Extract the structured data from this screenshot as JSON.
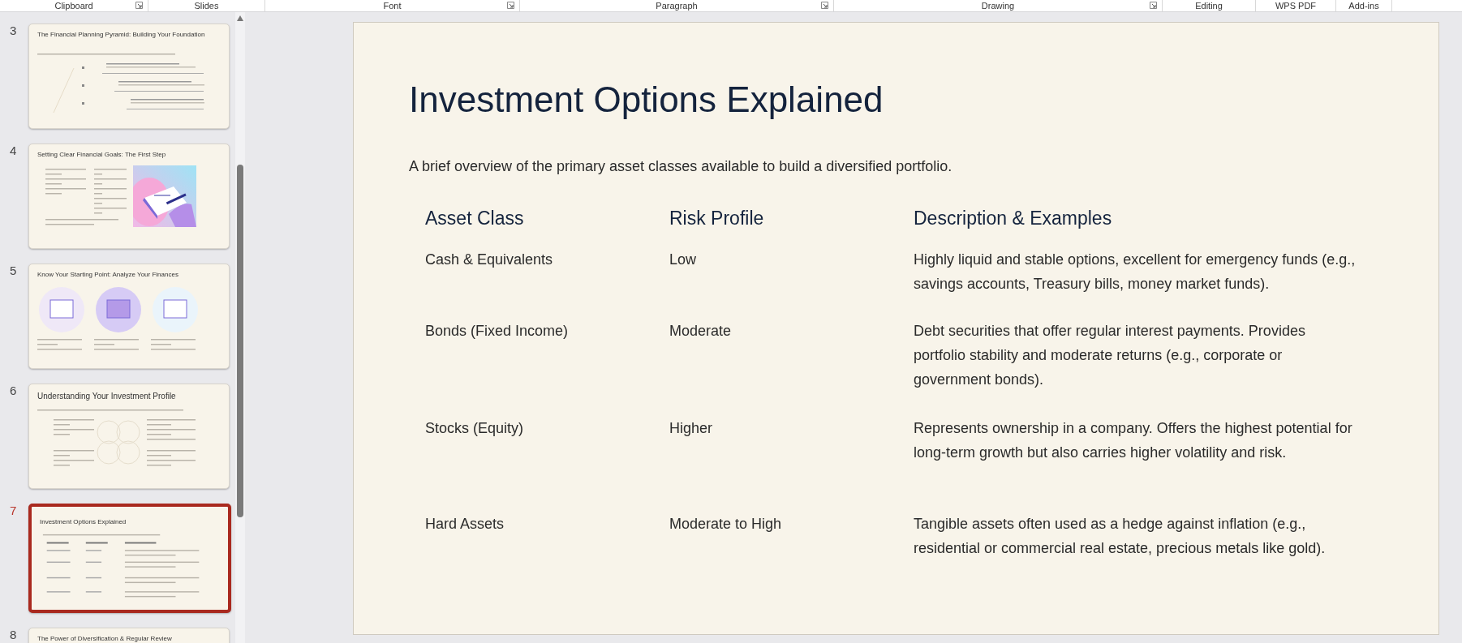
{
  "ribbon": {
    "groups": [
      {
        "label": "Clipboard",
        "launcher": true
      },
      {
        "label": "Slides",
        "launcher": false
      },
      {
        "label": "Font",
        "launcher": true
      },
      {
        "label": "Paragraph",
        "launcher": true
      },
      {
        "label": "Drawing",
        "launcher": true
      },
      {
        "label": "Editing",
        "launcher": false
      },
      {
        "label": "WPS PDF",
        "launcher": false
      },
      {
        "label": "Add-ins",
        "launcher": false
      }
    ]
  },
  "thumbnails": [
    {
      "number": "3",
      "title": "The Financial Planning Pyramid: Building Your Foundation",
      "kind": "pyramid",
      "selected": false
    },
    {
      "number": "4",
      "title": "Setting Clear Financial Goals: The First Step",
      "kind": "goals",
      "selected": false
    },
    {
      "number": "5",
      "title": "Know Your Starting Point: Analyze Your Finances",
      "kind": "circles",
      "selected": false
    },
    {
      "number": "6",
      "title": "Understanding Your Investment Profile",
      "kind": "profile",
      "selected": false
    },
    {
      "number": "7",
      "title": "Investment Options Explained",
      "kind": "table",
      "selected": true
    },
    {
      "number": "8",
      "title": "The Power of Diversification & Regular Review",
      "kind": "cut",
      "selected": false
    }
  ],
  "slide": {
    "title": "Investment Options Explained",
    "subtitle": "A brief overview of the primary asset classes available to build a diversified portfolio.",
    "columns": [
      "Asset Class",
      "Risk Profile",
      "Description & Examples"
    ],
    "rows": [
      {
        "asset_class": "Cash & Equivalents",
        "risk_profile": "Low",
        "description": "Highly liquid and stable options, excellent for emergency funds (e.g., savings accounts, Treasury bills, money market funds)."
      },
      {
        "asset_class": "Bonds (Fixed Income)",
        "risk_profile": "Moderate",
        "description": "Debt securities that offer regular interest payments. Provides portfolio stability and moderate returns (e.g., corporate or government bonds)."
      },
      {
        "asset_class": "Stocks (Equity)",
        "risk_profile": "Higher",
        "description": "Represents ownership in a company. Offers the highest potential for long-term growth but also carries higher volatility and risk."
      },
      {
        "asset_class": "Hard Assets",
        "risk_profile": "Moderate to High",
        "description": "Tangible assets often used as a hedge against inflation (e.g., residential or commercial real estate, precious metals like gold)."
      }
    ]
  }
}
